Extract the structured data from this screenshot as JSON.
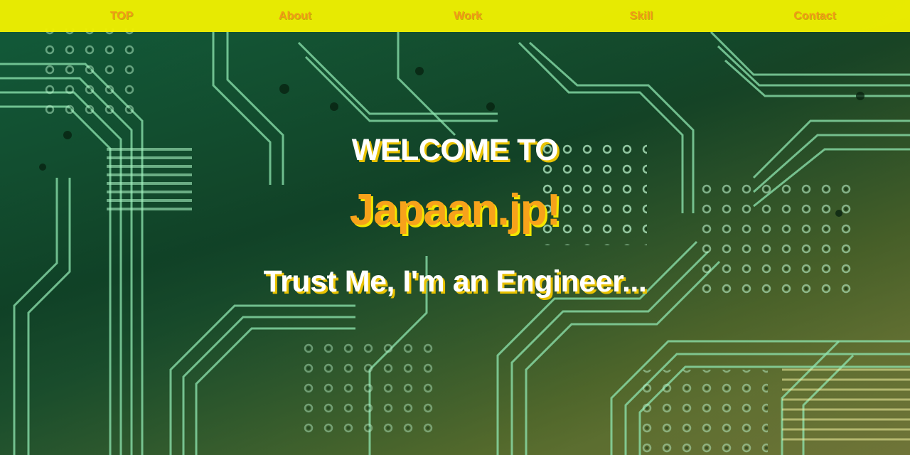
{
  "navbar": {
    "items": [
      {
        "label": "TOP"
      },
      {
        "label": "About"
      },
      {
        "label": "Work"
      },
      {
        "label": "Skill"
      },
      {
        "label": "Contact"
      }
    ]
  },
  "hero": {
    "welcome": "WELCOME TO",
    "site_name": "Japaan.jp!",
    "tagline": "Trust Me, I'm an Engineer..."
  },
  "colors": {
    "navbar_bg": "#f0f000",
    "nav_text": "#f29a17",
    "site_name": "#f7a21b",
    "hero_text": "#ffffff",
    "hero_shadow": "#e9c200",
    "overlay_green": "#2e9e6e",
    "overlay_yellow": "#d8d87a"
  },
  "icons": {
    "background": "circuit-board-image"
  }
}
